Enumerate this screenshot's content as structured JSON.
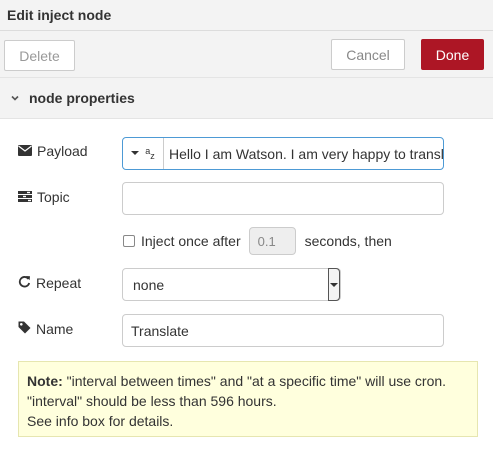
{
  "dialog": {
    "title": "Edit inject node"
  },
  "toolbar": {
    "delete_label": "Delete",
    "cancel_label": "Cancel",
    "done_label": "Done",
    "done_color": "#AD1625"
  },
  "section": {
    "title": "node properties",
    "icon": "chevron-down-icon"
  },
  "payload": {
    "label": "Payload",
    "icon": "envelope-icon",
    "type_icon": "string-type-icon",
    "type_glyph_sup": "a",
    "type_glyph_sub": "z",
    "value": "Hello I am Watson. I am very happy to translate"
  },
  "topic": {
    "label": "Topic",
    "icon": "tasks-icon",
    "value": ""
  },
  "once": {
    "checked": false,
    "label": "Inject once after",
    "delay_value": "0.1",
    "suffix": "seconds, then"
  },
  "repeat": {
    "label": "Repeat",
    "icon": "repeat-icon",
    "selected": "none"
  },
  "name": {
    "label": "Name",
    "icon": "tag-icon",
    "value": "Translate"
  },
  "note": {
    "bold_label": "Note:",
    "line1": " \"interval between times\" and \"at a specific time\" will use cron.",
    "line2": "\"interval\" should be less than 596 hours.",
    "line3": "See info box for details."
  }
}
